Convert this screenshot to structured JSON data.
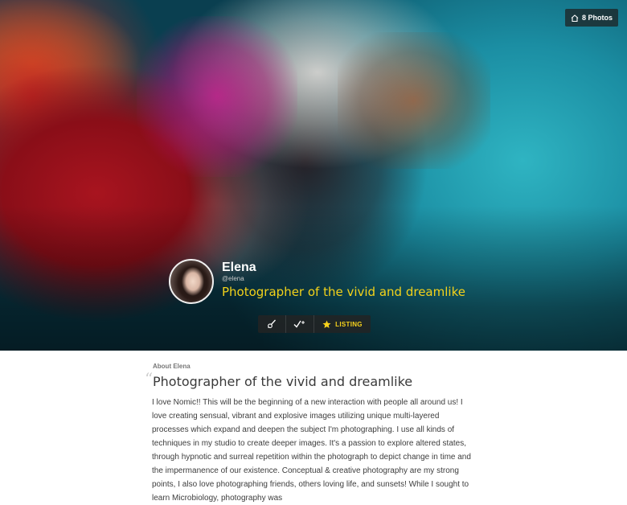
{
  "hero": {
    "photos_badge": {
      "icon": "home-icon",
      "label": "8 Photos"
    },
    "profile": {
      "name": "Elena",
      "handle": "@elena",
      "tagline": "Photographer of the vivid and dreamlike"
    },
    "actions": [
      {
        "icon": "brush-icon"
      },
      {
        "icon": "check-plus-icon"
      },
      {
        "icon": "star-icon",
        "label": "LISTING",
        "accent": "#f7d21c"
      }
    ]
  },
  "about": {
    "label": "About Elena",
    "headline": "Photographer of the vivid and dreamlike",
    "bio": "I love Nomic!! This will be the beginning of a new interaction with people all around us! I love creating sensual, vibrant and explosive images utilizing unique multi-layered processes which expand and deepen the subject I'm photographing. I use all kinds of techniques in my studio to create deeper images. It's a passion to explore altered states, through hypnotic and surreal repetition within the photograph to depict change in time and the impermanence of our existence. Conceptual & creative photography are my strong points, I also love photographing friends, others loving life, and sunsets! While I sought to learn Microbiology, photography was"
  }
}
